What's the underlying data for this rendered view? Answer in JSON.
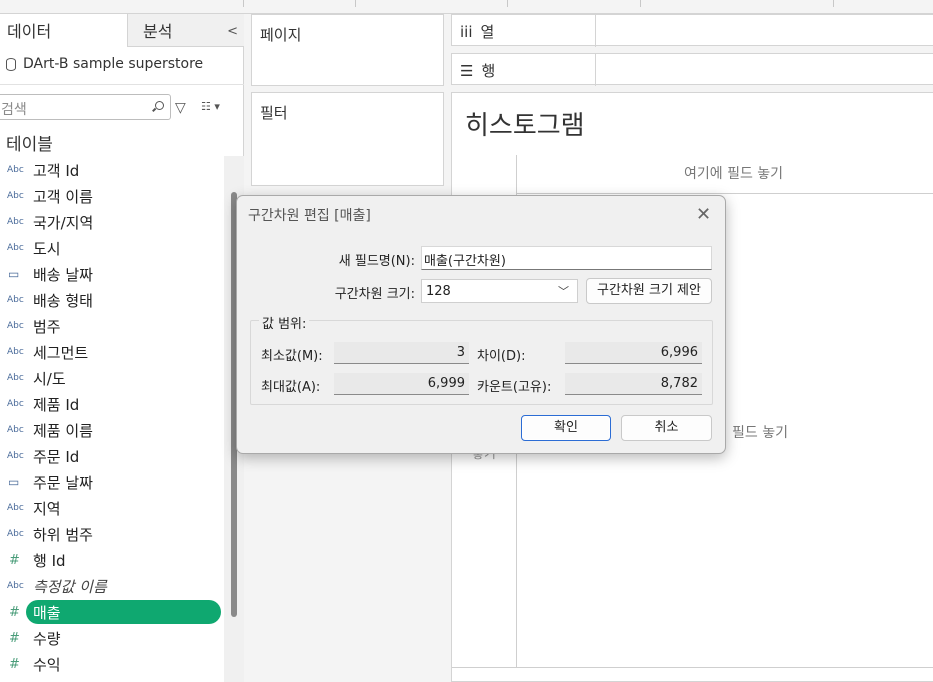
{
  "data_pane": {
    "tab_data": "데이터",
    "tab_analysis": "분석",
    "collapse_glyph": "<",
    "datasource": "DArt-B sample superstore",
    "search_placeholder": "검색",
    "tables_title": "테이블",
    "fields": [
      {
        "type": "Abc",
        "name": "고객 Id"
      },
      {
        "type": "Abc",
        "name": "고객 이름"
      },
      {
        "type": "Abc",
        "name": "국가/지역"
      },
      {
        "type": "Abc",
        "name": "도시"
      },
      {
        "type": "calendar",
        "name": "배송 날짜"
      },
      {
        "type": "Abc",
        "name": "배송 형태"
      },
      {
        "type": "Abc",
        "name": "범주"
      },
      {
        "type": "Abc",
        "name": "세그먼트"
      },
      {
        "type": "Abc",
        "name": "시/도"
      },
      {
        "type": "Abc",
        "name": "제품 Id"
      },
      {
        "type": "Abc",
        "name": "제품 이름"
      },
      {
        "type": "Abc",
        "name": "주문 Id"
      },
      {
        "type": "calendar",
        "name": "주문 날짜"
      },
      {
        "type": "Abc",
        "name": "지역"
      },
      {
        "type": "Abc",
        "name": "하위 범주"
      },
      {
        "type": "#",
        "name": "행 Id"
      },
      {
        "type": "Abc",
        "name": "측정값 이름",
        "italic": true
      },
      {
        "type": "#",
        "name": "매출",
        "selected": true
      },
      {
        "type": "#",
        "name": "수량"
      },
      {
        "type": "#",
        "name": "수익"
      }
    ],
    "selected_color": "#0fa870"
  },
  "cards": {
    "pages": "페이지",
    "filters": "필터"
  },
  "shelves": {
    "columns_icon": "iii",
    "columns": "열",
    "rows_icon": "☰",
    "rows": "행"
  },
  "view": {
    "title": "히스토그램",
    "drop_field_top": "여기에 필드 놓기",
    "drop_field_middle": "필드 놓기",
    "drop_field_left": "놓기"
  },
  "dialog": {
    "title": "구간차원 편집 [매출]",
    "new_field_label": "새 필드명(N):",
    "new_field_value": "매출(구간차원)",
    "bin_size_label": "구간차원 크기:",
    "bin_size_value": "128",
    "suggest_button": "구간차원 크기 제안",
    "range_group": "값 범위:",
    "min_label": "최소값(M):",
    "min_value": "3",
    "diff_label": "차이(D):",
    "diff_value": "6,996",
    "max_label": "최대값(A):",
    "max_value": "6,999",
    "count_label": "카운트(고유):",
    "count_value": "8,782",
    "ok_button": "확인",
    "cancel_button": "취소",
    "close_glyph": "✕"
  }
}
